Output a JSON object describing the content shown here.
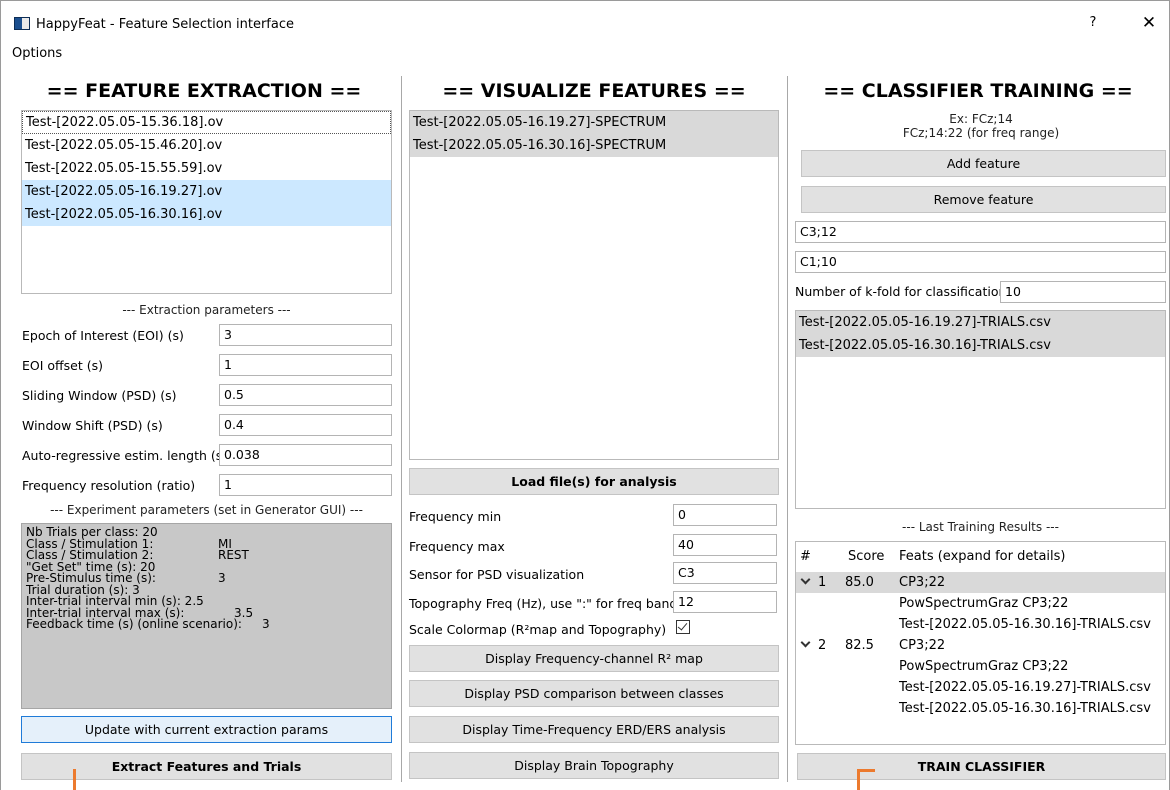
{
  "window": {
    "title": "HappyFeat - Feature Selection interface",
    "help": "?",
    "close": "✕"
  },
  "menu": {
    "options": "Options"
  },
  "extraction": {
    "heading": "== FEATURE EXTRACTION ==",
    "files": [
      {
        "name": "Test-[2022.05.05-15.36.18].ov",
        "state": "current"
      },
      {
        "name": "Test-[2022.05.05-15.46.20].ov",
        "state": "none"
      },
      {
        "name": "Test-[2022.05.05-15.55.59].ov",
        "state": "none"
      },
      {
        "name": "Test-[2022.05.05-16.19.27].ov",
        "state": "selected"
      },
      {
        "name": "Test-[2022.05.05-16.30.16].ov",
        "state": "selected"
      }
    ],
    "params_label": "--- Extraction parameters ---",
    "params": [
      {
        "label": "Epoch of Interest (EOI) (s)",
        "value": "3"
      },
      {
        "label": "EOI offset (s)",
        "value": "1"
      },
      {
        "label": "Sliding Window (PSD) (s)",
        "value": "0.5"
      },
      {
        "label": "Window Shift (PSD) (s)",
        "value": "0.4"
      },
      {
        "label": "Auto-regressive estim. length (s)",
        "value": "0.038"
      },
      {
        "label": "Frequency resolution (ratio)",
        "value": "1"
      }
    ],
    "exp_label": "--- Experiment parameters (set in Generator GUI) ---",
    "exp_params": [
      {
        "label": "Nb Trials per class:  20",
        "value": ""
      },
      {
        "label": "Class / Stimulation 1:",
        "value": "MI"
      },
      {
        "label": "Class / Stimulation 2:",
        "value": "REST"
      },
      {
        "label": "\"Get Set\" time (s):  20",
        "value": ""
      },
      {
        "label": "Pre-Stimulus time (s):",
        "value": "3"
      },
      {
        "label": "Trial duration (s):   3",
        "value": ""
      },
      {
        "label": "Inter-trial interval min (s): 2.5",
        "value": ""
      },
      {
        "label": "Inter-trial interval max (s):",
        "value": "3.5"
      },
      {
        "label": "Feedback time (s) (online scenario):",
        "value": "3"
      }
    ],
    "update_button": "Update with current extraction params",
    "extract_button": "Extract Features and Trials"
  },
  "visualize": {
    "heading": "== VISUALIZE FEATURES ==",
    "files": [
      {
        "name": "Test-[2022.05.05-16.19.27]-SPECTRUM"
      },
      {
        "name": "Test-[2022.05.05-16.30.16]-SPECTRUM"
      }
    ],
    "load_button": "Load file(s) for analysis",
    "params": [
      {
        "label": "Frequency min",
        "value": "0"
      },
      {
        "label": "Frequency max",
        "value": "40"
      },
      {
        "label": "Sensor for PSD visualization",
        "value": "C3"
      },
      {
        "label": "Topography Freq (Hz), use \":\" for freq band",
        "value": "12"
      }
    ],
    "scale_label": "Scale Colormap (R²map and Topography)",
    "scale_checked": true,
    "buttons": [
      "Display Frequency-channel R² map",
      "Display PSD comparison between classes",
      "Display Time-Frequency ERD/ERS analysis",
      "Display Brain Topography"
    ]
  },
  "training": {
    "heading": "== CLASSIFIER TRAINING ==",
    "hint_line1": "Ex: FCz;14",
    "hint_line2": "FCz;14:22 (for freq range)",
    "add_button": "Add feature",
    "remove_button": "Remove feature",
    "features": [
      "C3;12",
      "C1;10"
    ],
    "kfold_label": "Number of k-fold for classification",
    "kfold_value": "10",
    "trial_files": [
      {
        "name": "Test-[2022.05.05-16.19.27]-TRIALS.csv"
      },
      {
        "name": "Test-[2022.05.05-16.30.16]-TRIALS.csv"
      }
    ],
    "results_label": "--- Last Training Results ---",
    "results_headers": {
      "num": "#",
      "score": "Score",
      "feats": "Feats (expand for details)"
    },
    "results": [
      {
        "num": "1",
        "score": "85.0",
        "feat": "CP3;22",
        "details": [
          "PowSpectrumGraz CP3;22",
          "Test-[2022.05.05-16.30.16]-TRIALS.csv"
        ]
      },
      {
        "num": "2",
        "score": "82.5",
        "feat": "CP3;22",
        "details": [
          "PowSpectrumGraz CP3;22",
          "Test-[2022.05.05-16.19.27]-TRIALS.csv",
          "Test-[2022.05.05-16.30.16]-TRIALS.csv"
        ]
      }
    ],
    "train_button": "TRAIN CLASSIFIER"
  },
  "colors": {
    "selection_blue": "#cce8ff",
    "selection_gray": "#d9d9d9",
    "info_gray": "#c8c8c8",
    "focus_blue": "#1f7bd8",
    "annotation_orange": "#ec7a2e"
  }
}
